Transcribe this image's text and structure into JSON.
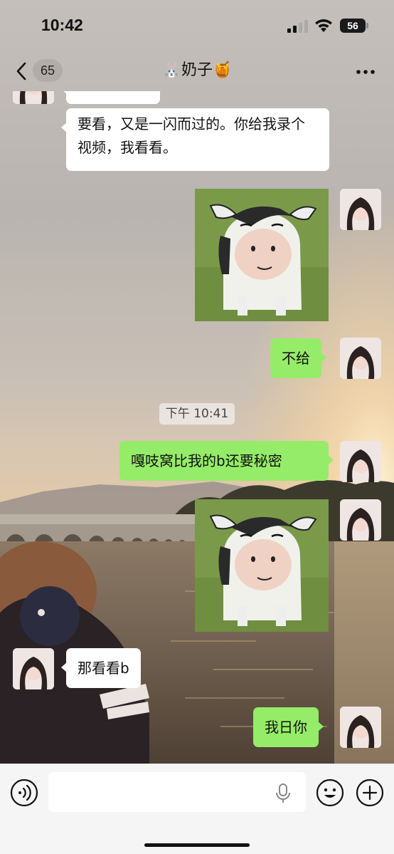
{
  "status_bar": {
    "time": "10:42",
    "battery": "56"
  },
  "nav": {
    "unread_count": "65",
    "title": "🐰奶子🍯"
  },
  "messages": [
    {
      "side": "in",
      "type": "text",
      "text": "要看，又是一闪而过的。你给我录个视频，我看看。"
    },
    {
      "side": "out",
      "type": "sticker",
      "sticker": "cow-sticker"
    },
    {
      "side": "out",
      "type": "text",
      "text": "不给"
    },
    {
      "side": "out",
      "type": "text",
      "text": "嘎吱窝比我的b还要秘密"
    },
    {
      "side": "out",
      "type": "sticker",
      "sticker": "cow-sticker"
    },
    {
      "side": "in",
      "type": "text",
      "text": "那看看b"
    },
    {
      "side": "out",
      "type": "text",
      "text": "我日你"
    }
  ],
  "time_divider": "下午 10:41",
  "input": {
    "placeholder": ""
  },
  "colors": {
    "outgoing_bubble": "#95ec69",
    "incoming_bubble": "#ffffff",
    "input_bar": "#f5f5f5"
  },
  "icons": [
    "back-icon",
    "more-icon",
    "signal-icon",
    "wifi-icon",
    "battery-icon",
    "voice-icon",
    "mic-icon",
    "emoji-icon",
    "plus-icon"
  ]
}
